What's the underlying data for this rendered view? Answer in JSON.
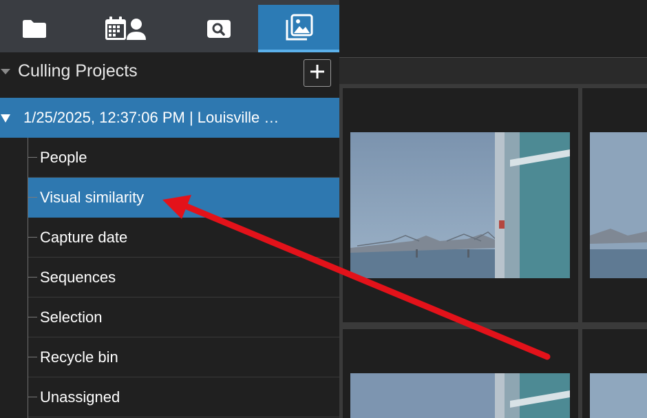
{
  "tabs": [
    {
      "name": "folder-icon"
    },
    {
      "name": "calendar-person-icon"
    },
    {
      "name": "search-icon"
    },
    {
      "name": "photo-stack-icon",
      "active": true
    }
  ],
  "sidebar": {
    "section_title": "Culling Projects",
    "add_label": "+",
    "project_label": "1/25/2025, 12:37:06 PM | Louisville …",
    "items": [
      {
        "label": "People"
      },
      {
        "label": "Visual similarity",
        "selected": true
      },
      {
        "label": "Capture date"
      },
      {
        "label": "Sequences"
      },
      {
        "label": "Selection"
      },
      {
        "label": "Recycle bin"
      },
      {
        "label": "Unassigned"
      }
    ]
  },
  "colors": {
    "accent": "#2e78b0",
    "annotation_arrow": "#e3121a"
  }
}
